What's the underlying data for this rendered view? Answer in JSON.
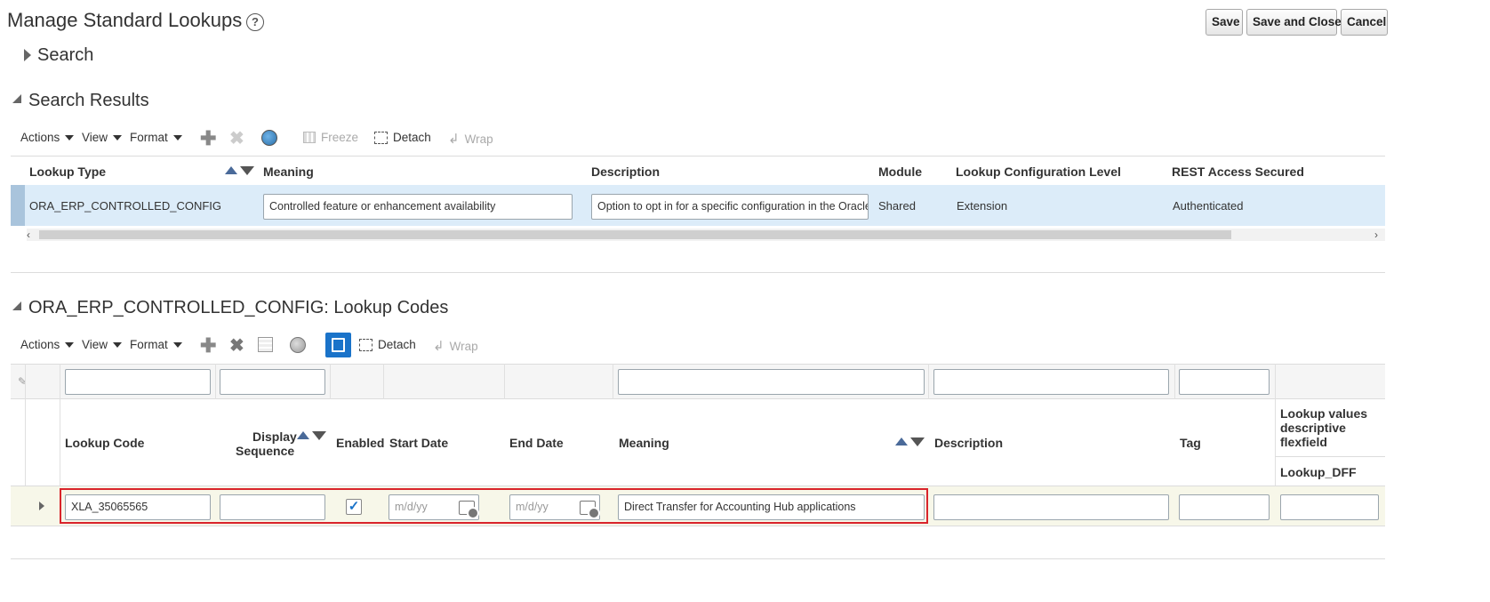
{
  "header": {
    "title": "Manage Standard Lookups",
    "help_icon": "question-circle-icon",
    "buttons": {
      "save": "Save",
      "save_close": "Save and Close",
      "cancel": "Cancel"
    }
  },
  "search": {
    "title": "Search"
  },
  "results": {
    "title": "Search Results",
    "toolbar": {
      "actions": "Actions",
      "view": "View",
      "format": "Format",
      "freeze": "Freeze",
      "detach": "Detach",
      "wrap": "Wrap"
    },
    "columns": {
      "lookup_type": "Lookup Type",
      "meaning": "Meaning",
      "description": "Description",
      "module": "Module",
      "config_level": "Lookup Configuration Level",
      "rest": "REST Access Secured"
    },
    "row": {
      "lookup_type": "ORA_ERP_CONTROLLED_CONFIG",
      "meaning": "Controlled feature or enhancement availability",
      "description": "Option to opt in for a specific configuration in the Oracle",
      "module": "Shared",
      "config_level": "Extension",
      "rest": "Authenticated"
    }
  },
  "codes": {
    "title": "ORA_ERP_CONTROLLED_CONFIG: Lookup Codes",
    "toolbar": {
      "actions": "Actions",
      "view": "View",
      "format": "Format",
      "detach": "Detach",
      "wrap": "Wrap"
    },
    "columns": {
      "lookup_code": "Lookup Code",
      "display_seq_1": "Display",
      "display_seq_2": "Sequence",
      "enabled": "Enabled",
      "start_date": "Start Date",
      "end_date": "End Date",
      "meaning": "Meaning",
      "description": "Description",
      "tag": "Tag",
      "dff_1": "Lookup values",
      "dff_2": "descriptive",
      "dff_3": "flexfield",
      "dff_sub": "Lookup_DFF"
    },
    "row": {
      "lookup_code": "XLA_35065565",
      "display_seq": "",
      "enabled": true,
      "start_placeholder": "m/d/yy",
      "end_placeholder": "m/d/yy",
      "meaning": "Direct Transfer for Accounting Hub applications",
      "description": "",
      "tag": "",
      "dff": ""
    }
  },
  "colors": {
    "selected_row": "#dcecf9",
    "highlight_border": "#d9242b",
    "accent": "#1a73c9",
    "new_row": "#f7f7e9"
  }
}
